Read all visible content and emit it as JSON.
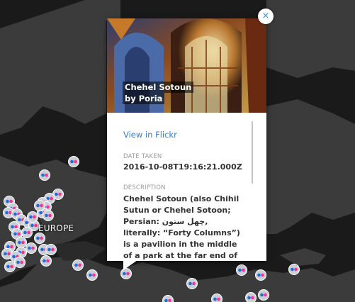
{
  "map": {
    "region_label": "EUROPE",
    "colors": {
      "land": "#3b3b3b",
      "water": "#1a1a1a",
      "marker_bg": "#c9ced6",
      "pink": "#ff2f8f",
      "blue": "#1b6fd6"
    }
  },
  "popup": {
    "photo_title": "Chehel Sotoun",
    "photo_author": "by Poria",
    "view_link": "View in Flickr",
    "date_label": "DATE TAKEN",
    "date_value": "2016-10-08T19:16:21.000Z",
    "description_label": "DESCRIPTION",
    "description": "Chehel Sotoun (also Chihil Sutun or Chehel Sotoon; Persian: چهل ستون, literally: “Forty Columns”) is a pavilion in the middle of a park at the far end of a long pool, in Isfahan, Iran.",
    "close_icon": "close-icon",
    "close_glyph": "×"
  }
}
